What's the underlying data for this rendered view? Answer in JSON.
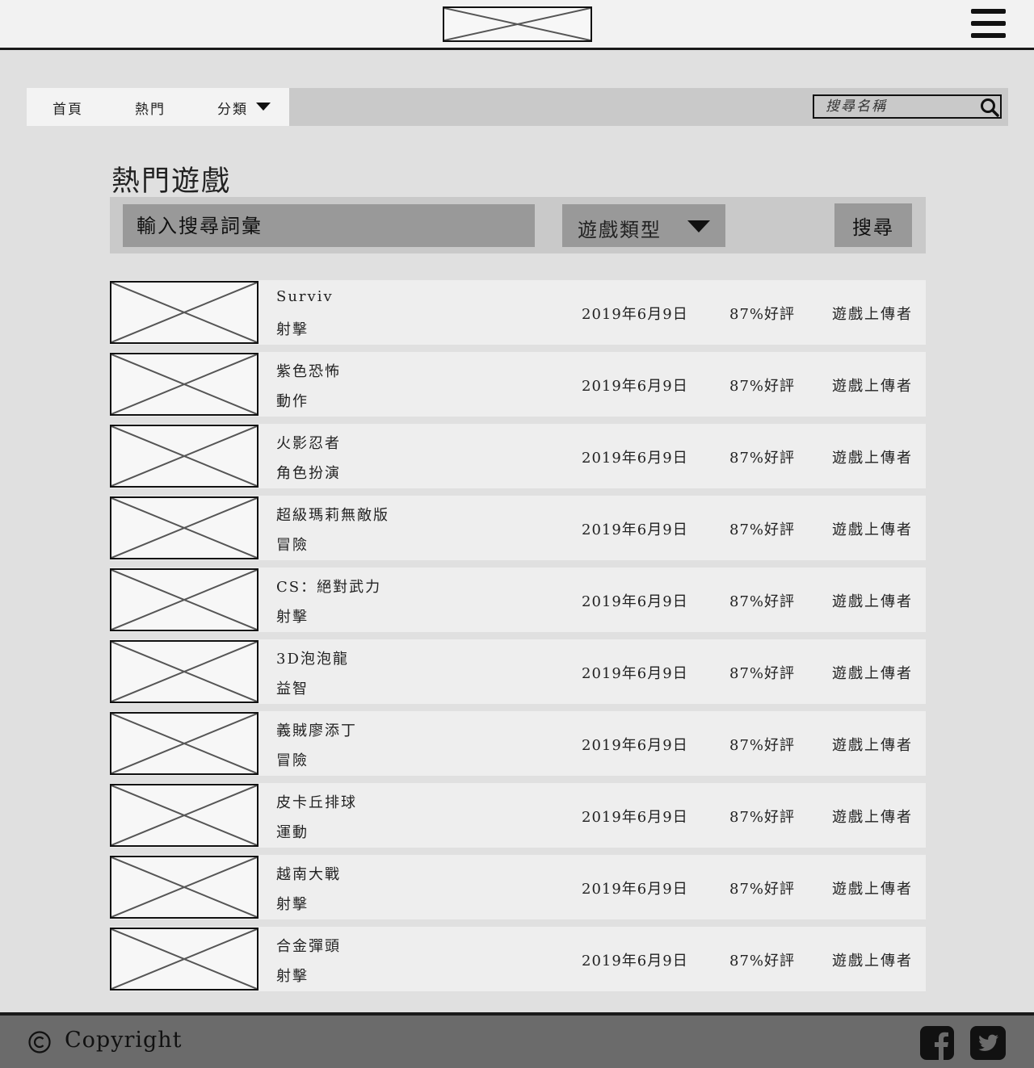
{
  "header": {
    "logo_icon": "image-placeholder-icon",
    "menu_icon": "hamburger-menu-icon"
  },
  "nav": {
    "home": "首頁",
    "hot": "熱門",
    "category": "分類",
    "category_icon": "caret-down-icon",
    "search_placeholder": "搜尋名稱",
    "search_icon": "search-icon"
  },
  "page_title": "熱門遊戲",
  "filter": {
    "keyword_placeholder": "輸入搜尋詞彙",
    "type_label": "遊戲類型",
    "type_icon": "caret-down-icon",
    "search_button": "搜尋"
  },
  "games": [
    {
      "name": "Surviv",
      "genre": "射擊",
      "date": "2019年6月9日",
      "rating": "87%好評",
      "uploader": "遊戲上傳者"
    },
    {
      "name": "紫色恐怖",
      "genre": "動作",
      "date": "2019年6月9日",
      "rating": "87%好評",
      "uploader": "遊戲上傳者"
    },
    {
      "name": "火影忍者",
      "genre": "角色扮演",
      "date": "2019年6月9日",
      "rating": "87%好評",
      "uploader": "遊戲上傳者"
    },
    {
      "name": "超級瑪莉無敵版",
      "genre": "冒險",
      "date": "2019年6月9日",
      "rating": "87%好評",
      "uploader": "遊戲上傳者"
    },
    {
      "name": "CS：絕對武力",
      "genre": "射擊",
      "date": "2019年6月9日",
      "rating": "87%好評",
      "uploader": "遊戲上傳者"
    },
    {
      "name": "3D泡泡龍",
      "genre": "益智",
      "date": "2019年6月9日",
      "rating": "87%好評",
      "uploader": "遊戲上傳者"
    },
    {
      "name": "義賊廖添丁",
      "genre": "冒險",
      "date": "2019年6月9日",
      "rating": "87%好評",
      "uploader": "遊戲上傳者"
    },
    {
      "name": "皮卡丘排球",
      "genre": "運動",
      "date": "2019年6月9日",
      "rating": "87%好評",
      "uploader": "遊戲上傳者"
    },
    {
      "name": "越南大戰",
      "genre": "射擊",
      "date": "2019年6月9日",
      "rating": "87%好評",
      "uploader": "遊戲上傳者"
    },
    {
      "name": "合金彈頭",
      "genre": "射擊",
      "date": "2019年6月9日",
      "rating": "87%好評",
      "uploader": "遊戲上傳者"
    }
  ],
  "footer": {
    "copyright": "Copyright",
    "copyright_icon": "copyright-icon",
    "facebook_icon": "facebook-icon",
    "twitter_icon": "twitter-icon"
  },
  "colors": {
    "page_bg": "#e0e0e0",
    "header_bg": "#f2f2f2",
    "navbar_bg": "#c9c9c9",
    "field_bg": "#999999",
    "row_bg": "#eeeeee",
    "footer_bg": "#6b6b6b"
  }
}
